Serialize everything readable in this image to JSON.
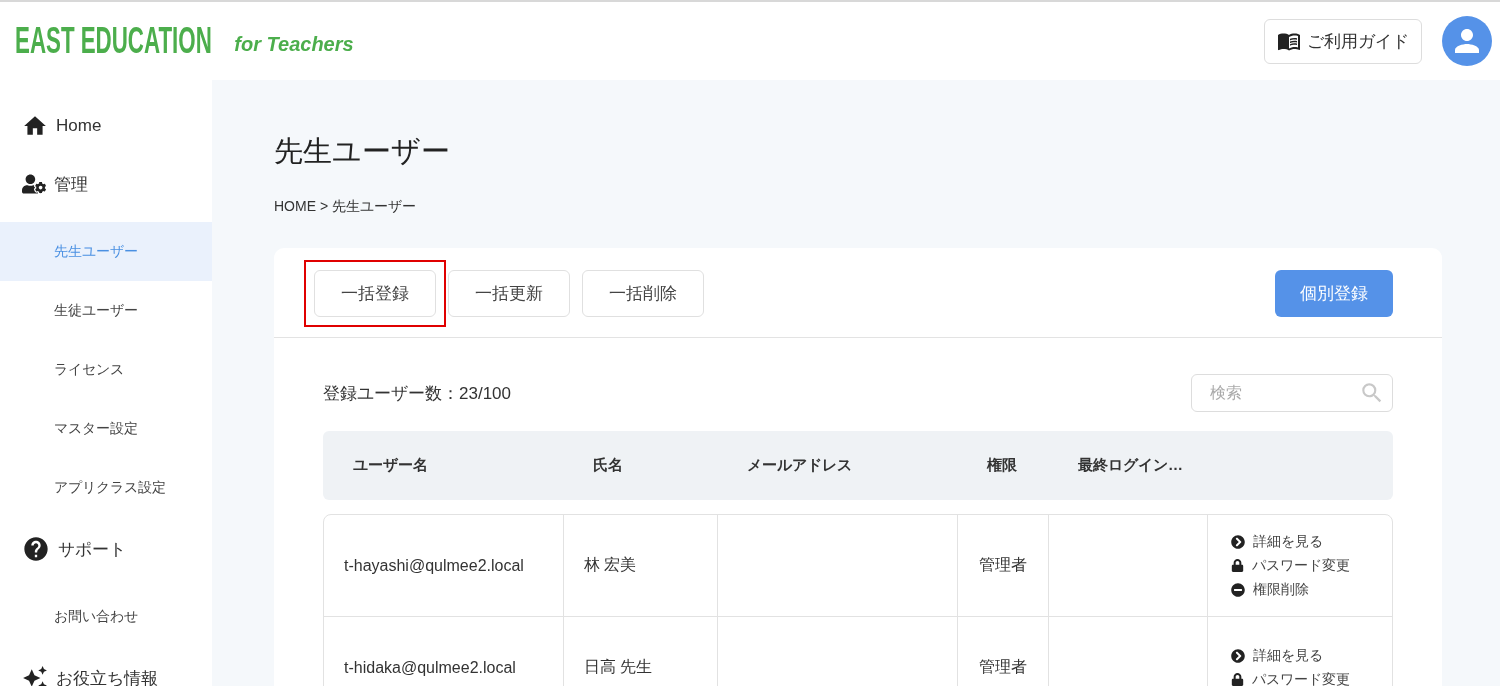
{
  "header": {
    "logo": "EAST EDUCATION",
    "logo_suffix": "for Teachers",
    "guide_button": "ご利用ガイド"
  },
  "sidebar": {
    "sections": [
      {
        "label": "Home"
      },
      {
        "label": "管理",
        "children": [
          {
            "label": "先生ユーザー",
            "selected": true
          },
          {
            "label": "生徒ユーザー",
            "selected": false
          },
          {
            "label": "ライセンス",
            "selected": false
          },
          {
            "label": "マスター設定",
            "selected": false
          },
          {
            "label": "アプリクラス設定",
            "selected": false
          }
        ]
      },
      {
        "label": "サポート",
        "children": [
          {
            "label": "お問い合わせ",
            "selected": false
          }
        ]
      },
      {
        "label": "お役立ち情報"
      }
    ]
  },
  "page": {
    "title": "先生ユーザー",
    "breadcrumb": "HOME > 先生ユーザー"
  },
  "toolbar": {
    "buttons": [
      {
        "label": "一括登録",
        "highlighted": true
      },
      {
        "label": "一括更新",
        "highlighted": false
      },
      {
        "label": "一括削除",
        "highlighted": false
      }
    ],
    "primary_button": "個別登録"
  },
  "user_count": "登録ユーザー数：23/100",
  "search": {
    "placeholder": "検索"
  },
  "table": {
    "columns": [
      "ユーザー名",
      "氏名",
      "メールアドレス",
      "権限",
      "最終ログイン…"
    ],
    "rows": [
      {
        "cells": [
          "t-hayashi@qulmee2.local",
          "林 宏美",
          "",
          "管理者",
          ""
        ],
        "actions": [
          {
            "kind": "detail",
            "label": "詳細を見る"
          },
          {
            "kind": "password",
            "label": "パスワード変更"
          },
          {
            "kind": "revoke",
            "label": "権限削除"
          }
        ]
      },
      {
        "cells": [
          "t-hidaka@qulmee2.local",
          "日高 先生",
          "",
          "管理者",
          ""
        ],
        "actions": [
          {
            "kind": "detail",
            "label": "詳細を見る"
          },
          {
            "kind": "password",
            "label": "パスワード変更"
          }
        ]
      }
    ]
  }
}
